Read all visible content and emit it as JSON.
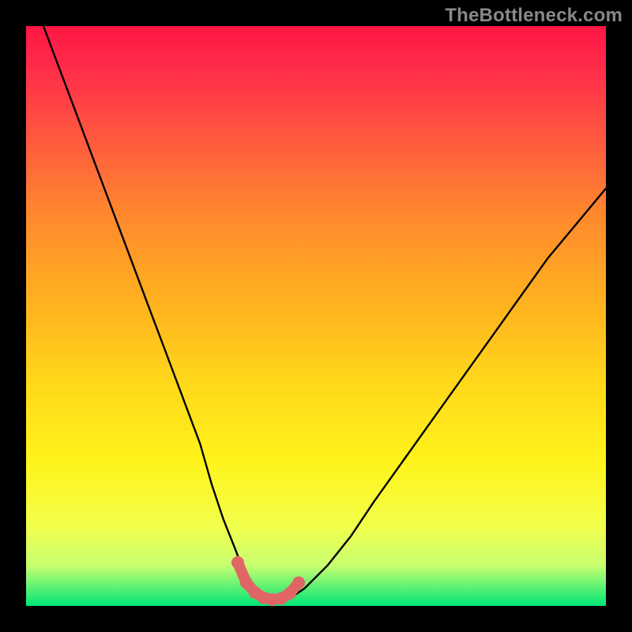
{
  "watermark": "TheBottleneck.com",
  "colors": {
    "gradient": [
      "#ff1744",
      "#ff2b4a",
      "#ff5440",
      "#ff8a2d",
      "#ffb21f",
      "#ffd91a",
      "#fff31a",
      "#f2ff4a",
      "#c8ff70",
      "#00e676"
    ],
    "curve": "#000000",
    "highlight": "#e06666"
  },
  "chart_data": {
    "type": "line",
    "title": "",
    "xlabel": "",
    "ylabel": "",
    "xlim": [
      0,
      100
    ],
    "ylim": [
      0,
      100
    ],
    "grid": false,
    "series": [
      {
        "name": "bottleneck-curve",
        "x": [
          3,
          6,
          9,
          12,
          15,
          18,
          21,
          24,
          27,
          30,
          32,
          34,
          36,
          37.5,
          39,
          41,
          43,
          45,
          48,
          52,
          56,
          60,
          65,
          70,
          75,
          80,
          85,
          90,
          95,
          100
        ],
        "y": [
          100,
          92,
          84,
          76,
          68,
          60,
          52,
          44,
          36,
          28,
          21,
          15,
          10,
          6,
          3,
          1.2,
          0.7,
          1.0,
          3,
          7,
          12,
          18,
          25,
          32,
          39,
          46,
          53,
          60,
          66,
          72
        ]
      }
    ],
    "highlight": {
      "name": "low-bottleneck-region",
      "x": [
        36.5,
        38,
        39.5,
        41,
        42.5,
        44,
        45.5,
        47
      ],
      "y": [
        7.5,
        4.0,
        2.3,
        1.4,
        1.1,
        1.3,
        2.2,
        4.0
      ]
    }
  }
}
